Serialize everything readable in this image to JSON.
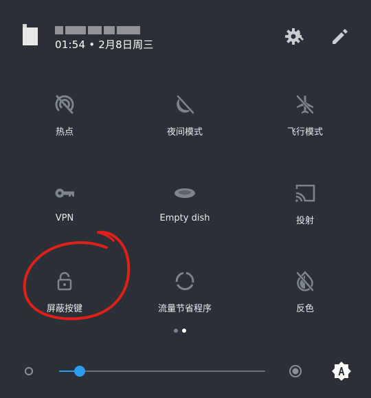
{
  "header": {
    "carrier_text": "",
    "datetime": "01:54 • 2月8日周三"
  },
  "tiles": [
    {
      "label": "热点",
      "icon": "hotspot-off-icon"
    },
    {
      "label": "夜间模式",
      "icon": "night-mode-off-icon"
    },
    {
      "label": "飞行模式",
      "icon": "airplane-mode-off-icon"
    },
    {
      "label": "VPN",
      "icon": "vpn-key-icon"
    },
    {
      "label": "Empty dish",
      "icon": "dish-icon"
    },
    {
      "label": "投射",
      "icon": "cast-icon"
    },
    {
      "label": "屏蔽按键",
      "icon": "lock-open-icon"
    },
    {
      "label": "流量节省程序",
      "icon": "data-saver-icon"
    },
    {
      "label": "反色",
      "icon": "invert-colors-off-icon"
    }
  ],
  "pagination": {
    "current_page": 2,
    "total_pages": 2
  },
  "brightness": {
    "level_fraction": 0.1
  },
  "colors": {
    "background": "#2b3036",
    "icon_off": "#7e848b",
    "accent": "#2d9bf0",
    "annotation": "#e0201b"
  }
}
